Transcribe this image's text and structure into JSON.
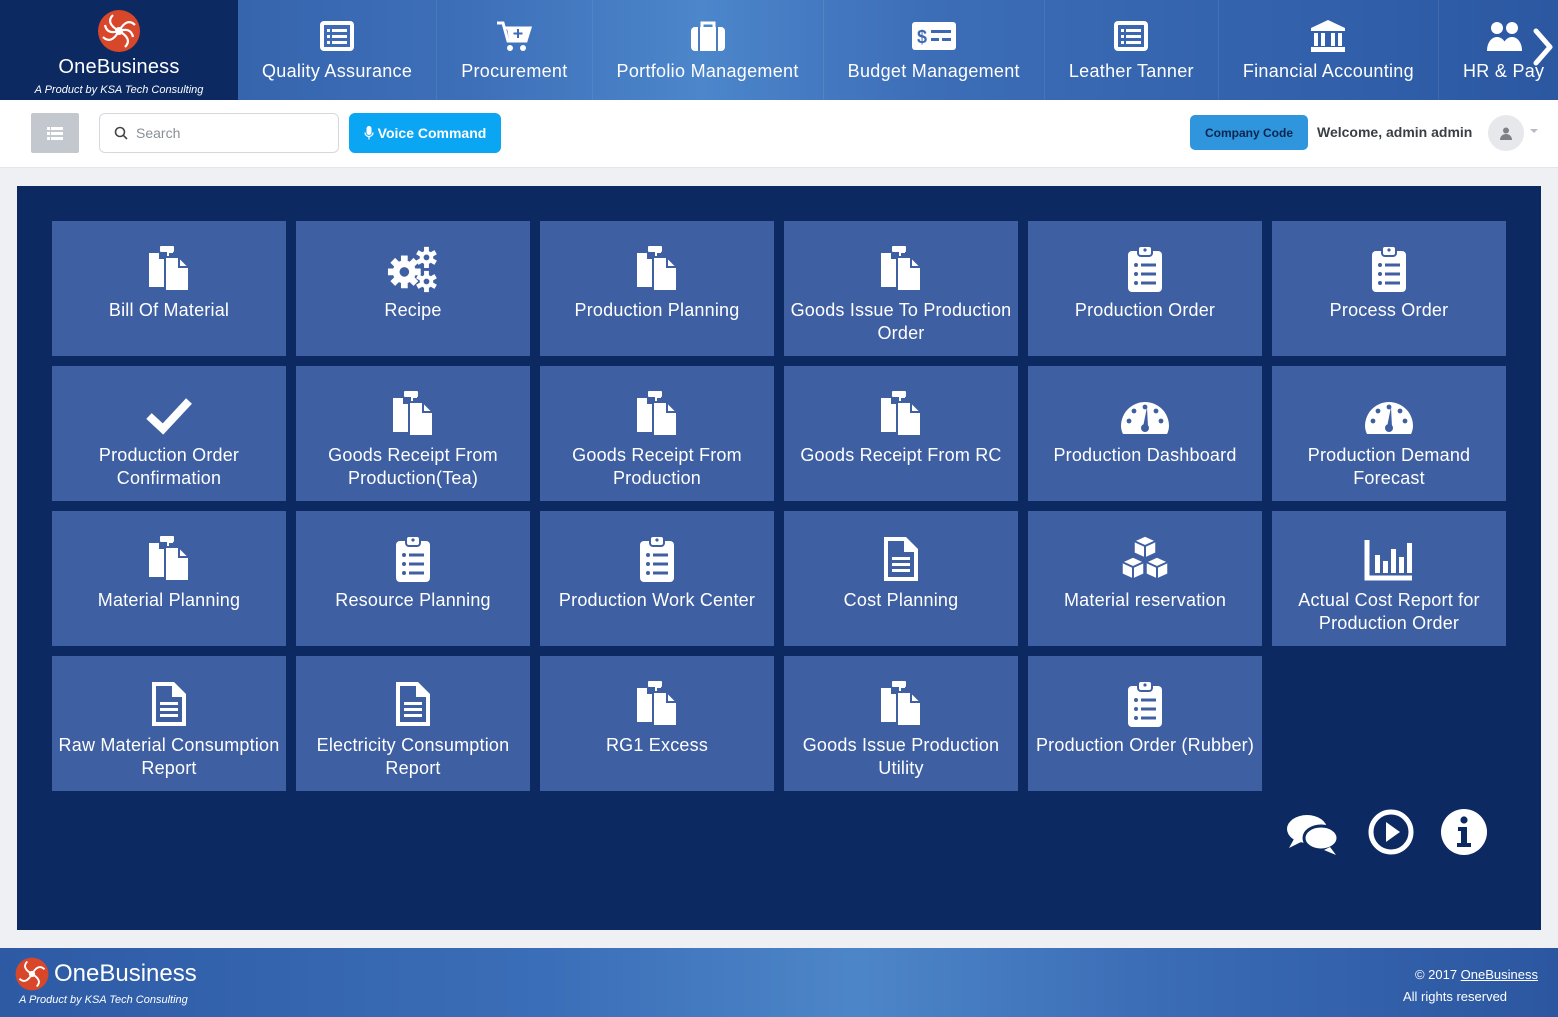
{
  "brand": {
    "name": "OneBusiness",
    "tagline": "A Product by KSA Tech Consulting",
    "logo_icon": "spiral-logo-icon",
    "colors": {
      "dark_navy": "#0c2a61",
      "tile_blue": "#3f5fa3",
      "accent": "#0aa5f3"
    }
  },
  "topnav": {
    "items": [
      {
        "label": "Quality Assurance",
        "icon": "list-alt-icon"
      },
      {
        "label": "Procurement",
        "icon": "cart-plus-icon"
      },
      {
        "label": "Portfolio Management",
        "icon": "briefcase-icon"
      },
      {
        "label": "Budget Management",
        "icon": "money-check-icon"
      },
      {
        "label": "Leather Tanner",
        "icon": "list-alt-icon"
      },
      {
        "label": "Financial Accounting",
        "icon": "bank-icon"
      },
      {
        "label": "HR & Pay",
        "icon": "users-icon"
      }
    ],
    "next_icon": "chevron-right-icon"
  },
  "toolbar": {
    "search_placeholder": "Search",
    "voice_label": "Voice Command",
    "company_label": "Company Code",
    "welcome": "Welcome, admin admin"
  },
  "tiles": [
    {
      "label": "Bill Of Material",
      "icon": "files-icon"
    },
    {
      "label": "Recipe",
      "icon": "cogs-icon"
    },
    {
      "label": "Production Planning",
      "icon": "files-icon"
    },
    {
      "label": "Goods Issue To Production Order",
      "icon": "files-icon"
    },
    {
      "label": "Production Order",
      "icon": "clipboard-list-icon"
    },
    {
      "label": "Process Order",
      "icon": "clipboard-list-icon"
    },
    {
      "label": "Production Order Confirmation",
      "icon": "check-icon"
    },
    {
      "label": "Goods Receipt From Production(Tea)",
      "icon": "files-icon"
    },
    {
      "label": "Goods Receipt From Production",
      "icon": "files-icon"
    },
    {
      "label": "Goods Receipt From RC",
      "icon": "files-icon"
    },
    {
      "label": "Production Dashboard",
      "icon": "gauge-icon"
    },
    {
      "label": "Production Demand Forecast",
      "icon": "gauge-icon"
    },
    {
      "label": "Material Planning",
      "icon": "files-icon"
    },
    {
      "label": "Resource Planning",
      "icon": "clipboard-list-icon"
    },
    {
      "label": "Production Work Center",
      "icon": "clipboard-list-icon"
    },
    {
      "label": "Cost Planning",
      "icon": "file-text-icon"
    },
    {
      "label": "Material reservation",
      "icon": "cubes-icon"
    },
    {
      "label": "Actual Cost Report for Production Order",
      "icon": "bar-chart-icon"
    },
    {
      "label": "Raw Material Consumption Report",
      "icon": "file-text-icon"
    },
    {
      "label": "Electricity Consumption Report",
      "icon": "file-text-icon"
    },
    {
      "label": "RG1 Excess",
      "icon": "files-icon"
    },
    {
      "label": "Goods Issue Production Utility",
      "icon": "files-icon"
    },
    {
      "label": "Production Order (Rubber)",
      "icon": "clipboard-list-icon"
    }
  ],
  "floating": [
    {
      "icon": "comments-icon"
    },
    {
      "icon": "play-circle-icon"
    },
    {
      "icon": "info-circle-icon"
    }
  ],
  "footer": {
    "name": "OneBusiness",
    "tagline": "A Product by KSA Tech Consulting",
    "copyright_prefix": "© 2017 ",
    "copyright_link": "OneBusiness",
    "rights": "All rights reserved"
  }
}
